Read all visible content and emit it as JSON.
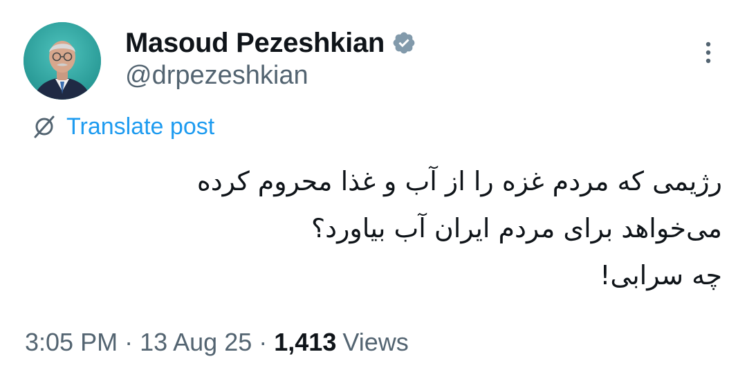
{
  "author": {
    "display_name": "Masoud Pezeshkian",
    "handle": "@drpezeshkian",
    "verified_icon": "verified-badge-icon",
    "verified_color": "#829aab"
  },
  "more_icon": "more-vertical-icon",
  "translate": {
    "icon": "globe-translate-icon",
    "label": "Translate post",
    "color": "#1d9bf0"
  },
  "tweet": {
    "lines": [
      "رژیمی که مردم غزه را از آب و غذا محروم کرده",
      "می‌خواهد برای مردم ایران آب بیاورد؟",
      "چه سرابی!"
    ]
  },
  "meta": {
    "time": "3:05 PM",
    "separator": "·",
    "date": "13 Aug 25",
    "views_count": "1,413",
    "views_label": "Views"
  }
}
